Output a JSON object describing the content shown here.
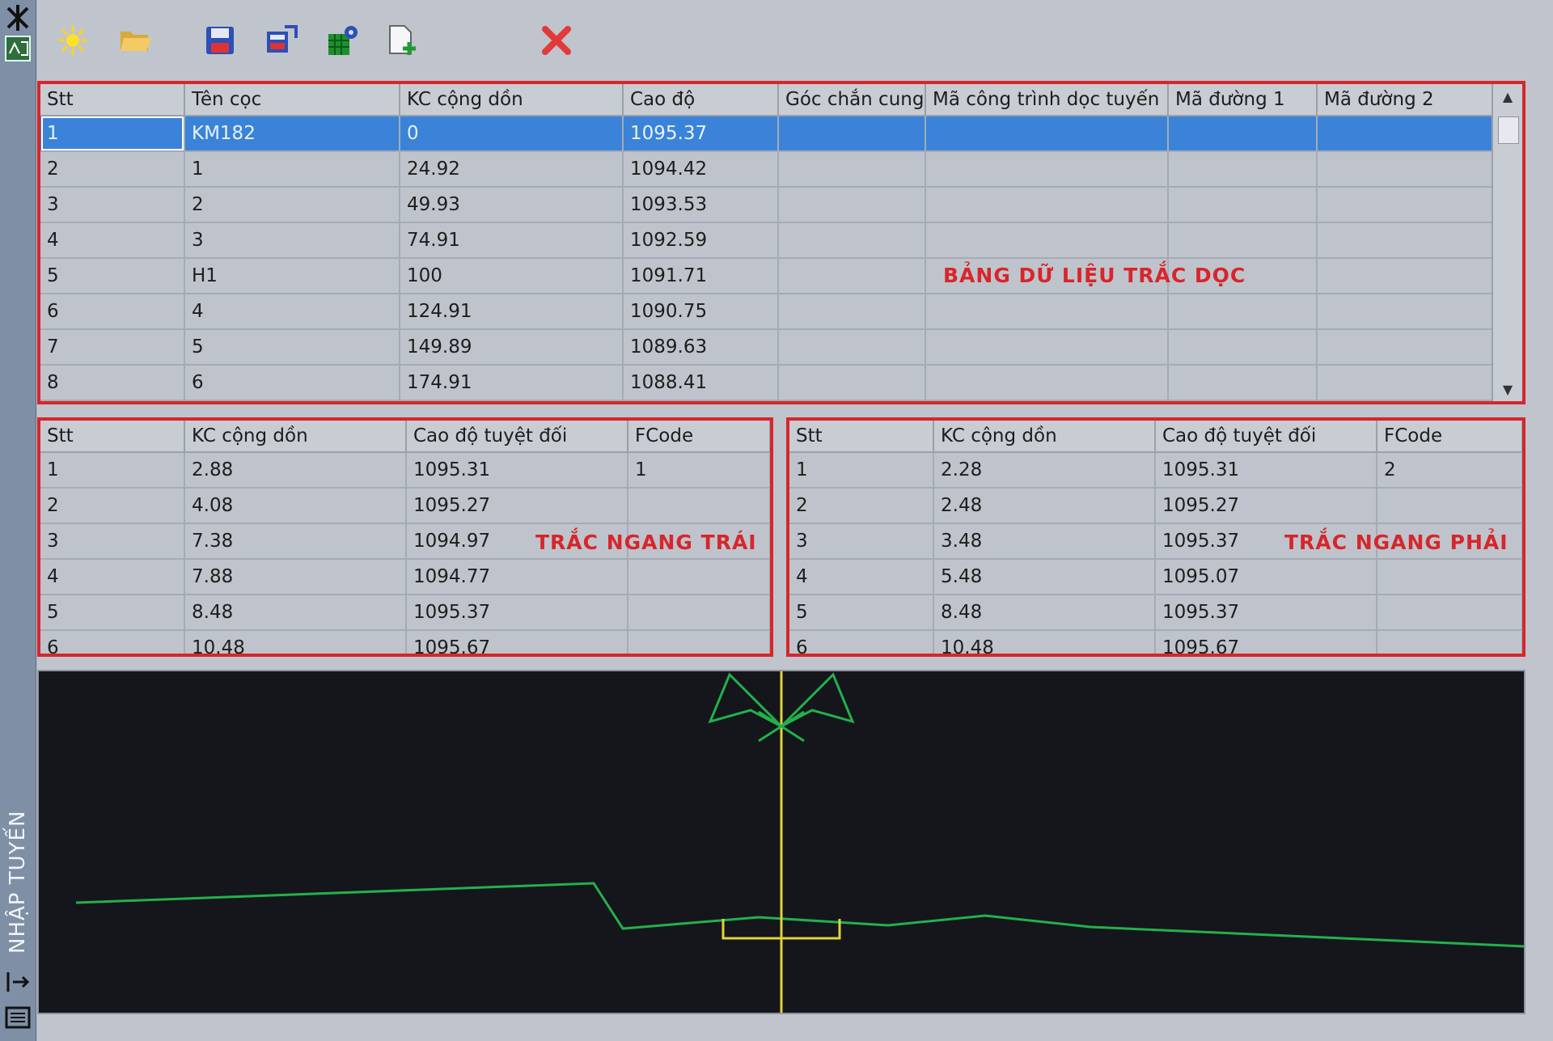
{
  "sidebar": {
    "title": "NHẬP TUYẾN",
    "icons": [
      "pin-icon",
      "app-icon",
      "expand-icon",
      "list-icon"
    ]
  },
  "toolbar": {
    "buttons": [
      {
        "name": "new-button",
        "icon": "sun-icon"
      },
      {
        "name": "open-button",
        "icon": "folder-open-icon"
      },
      {
        "name": "save-button",
        "icon": "floppy-icon"
      },
      {
        "name": "export-button",
        "icon": "export-icon"
      },
      {
        "name": "settings-button",
        "icon": "grid-settings-icon"
      },
      {
        "name": "add-file-button",
        "icon": "file-add-icon"
      },
      {
        "name": "delete-button",
        "icon": "red-x-icon"
      }
    ]
  },
  "profile_table": {
    "label": "BẢNG DỮ LIỆU TRẮC DỌC",
    "columns": [
      "Stt",
      "Tên cọc",
      "KC cộng dồn",
      "Cao độ",
      "Góc chắn cung",
      "Mã công trình dọc tuyến",
      "Mã đường 1",
      "Mã đường 2"
    ],
    "rows": [
      [
        "1",
        "KM182",
        "0",
        "1095.37",
        "",
        "",
        "",
        ""
      ],
      [
        "2",
        "1",
        "24.92",
        "1094.42",
        "",
        "",
        "",
        ""
      ],
      [
        "3",
        "2",
        "49.93",
        "1093.53",
        "",
        "",
        "",
        ""
      ],
      [
        "4",
        "3",
        "74.91",
        "1092.59",
        "",
        "",
        "",
        ""
      ],
      [
        "5",
        "H1",
        "100",
        "1091.71",
        "",
        "",
        "",
        ""
      ],
      [
        "6",
        "4",
        "124.91",
        "1090.75",
        "",
        "",
        "",
        ""
      ],
      [
        "7",
        "5",
        "149.89",
        "1089.63",
        "",
        "",
        "",
        ""
      ],
      [
        "8",
        "6",
        "174.91",
        "1088.41",
        "",
        "",
        "",
        ""
      ]
    ],
    "selected_row": 0
  },
  "left_cross_table": {
    "label": "TRẮC NGANG TRÁI",
    "columns": [
      "Stt",
      "KC cộng dồn",
      "Cao độ tuyệt đối",
      "FCode"
    ],
    "rows": [
      [
        "1",
        "2.88",
        "1095.31",
        "1"
      ],
      [
        "2",
        "4.08",
        "1095.27",
        ""
      ],
      [
        "3",
        "7.38",
        "1094.97",
        ""
      ],
      [
        "4",
        "7.88",
        "1094.77",
        ""
      ],
      [
        "5",
        "8.48",
        "1095.37",
        ""
      ],
      [
        "6",
        "10.48",
        "1095.67",
        ""
      ]
    ]
  },
  "right_cross_table": {
    "label": "TRẮC NGANG PHẢI",
    "columns": [
      "Stt",
      "KC cộng dồn",
      "Cao độ tuyệt đối",
      "FCode"
    ],
    "rows": [
      [
        "1",
        "2.28",
        "1095.31",
        "2"
      ],
      [
        "2",
        "2.48",
        "1095.27",
        ""
      ],
      [
        "3",
        "3.48",
        "1095.37",
        ""
      ],
      [
        "4",
        "5.48",
        "1095.07",
        ""
      ],
      [
        "5",
        "8.48",
        "1095.37",
        ""
      ],
      [
        "6",
        "10.48",
        "1095.67",
        ""
      ]
    ]
  },
  "colors": {
    "highlight_border": "#d7262b",
    "selection": "#3a83d9",
    "ground_line": "#22b14c",
    "centerline": "#e3d23a",
    "canvas_bg": "#14161b"
  }
}
